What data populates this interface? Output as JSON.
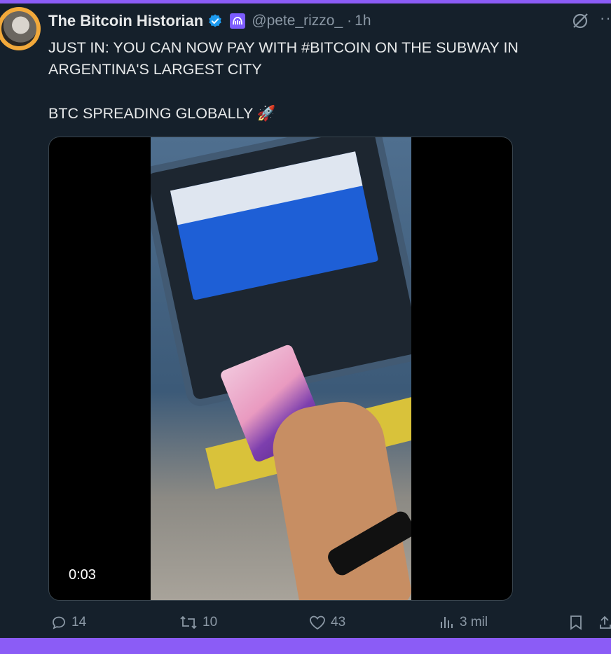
{
  "tweet": {
    "author_name": "The Bitcoin Historian",
    "handle": "@pete_rizzo_",
    "separator": "·",
    "time": "1h",
    "text_line1": "JUST IN: YOU CAN NOW PAY WITH #BITCOIN ON THE SUBWAY IN ARGENTINA'S LARGEST CITY",
    "text_line2": "BTC SPREADING GLOBALLY 🚀"
  },
  "video": {
    "duration": "0:03"
  },
  "actions": {
    "replies": "14",
    "reposts": "10",
    "likes": "43",
    "views": "3 mil"
  },
  "icons": [
    "verified-badge-icon",
    "affiliate-badge-icon",
    "grok-icon",
    "more-icon",
    "reply-icon",
    "repost-icon",
    "like-icon",
    "views-icon",
    "bookmark-icon",
    "share-icon"
  ],
  "colors": {
    "background": "#15202b",
    "frame": "#8b5cf6",
    "text": "#e7e9ea",
    "muted": "#8b98a5",
    "verified": "#1d9bf0"
  }
}
